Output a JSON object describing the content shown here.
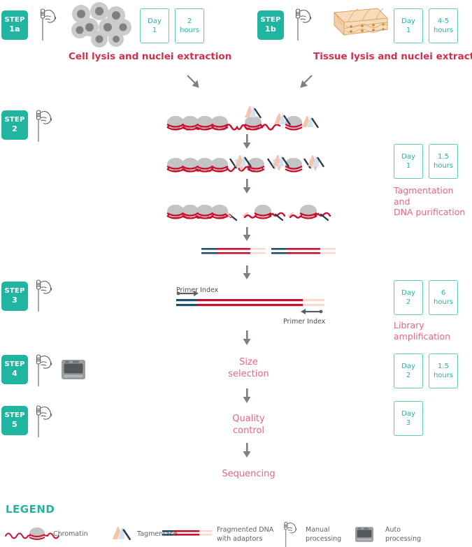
{
  "colors": {
    "teal": "#1fb5a0",
    "teal_light": "#62c9bd",
    "crimson": "#d2304a",
    "pink": "#e2697e",
    "gray_arrow": "#7d8083",
    "dna_red": "#c8102e",
    "dna_blue": "#1d4f6e",
    "dna_pale": "#fbd9d2",
    "nucleosome": "#c2c4c6",
    "tissue": "#f6d9b8",
    "tissue_line": "#d8953f"
  },
  "rows": {
    "step1a": {
      "badge_label": "STEP",
      "badge_num": "1a",
      "icon_manual": "hand-pipette-icon",
      "icon_sample": "cell-cluster-icon",
      "day": {
        "l1": "Day",
        "l2": "1"
      },
      "duration": {
        "l1": "2",
        "l2": "hours"
      },
      "caption": "Cell lysis and nuclei extraction"
    },
    "step1b": {
      "badge_label": "STEP",
      "badge_num": "1b",
      "icon_manual": "hand-pipette-icon",
      "icon_sample": "tissue-block-icon",
      "day": {
        "l1": "Day",
        "l2": "1"
      },
      "duration": {
        "l1": "4-5",
        "l2": "hours"
      },
      "caption": "Tissue lysis and nuclei extraction"
    },
    "step2": {
      "badge_label": "STEP",
      "badge_num": "2",
      "icon_manual": "hand-pipette-icon",
      "day": {
        "l1": "Day",
        "l2": "1"
      },
      "duration": {
        "l1": "1.5",
        "l2": "hours"
      },
      "side_label": "Tagmentation and\nDNA purification"
    },
    "step3": {
      "badge_label": "STEP",
      "badge_num": "3",
      "icon_manual": "hand-pipette-icon",
      "day": {
        "l1": "Day",
        "l2": "2"
      },
      "duration": {
        "l1": "6",
        "l2": "hours"
      },
      "side_label": "Library\namplification",
      "primer_top": "Primer Index",
      "primer_bottom": "Primer Index"
    },
    "step4": {
      "badge_label": "STEP",
      "badge_num": "4",
      "icon_manual": "hand-pipette-icon",
      "icon_auto": "auto-processor-icon",
      "day": {
        "l1": "Day",
        "l2": "2"
      },
      "duration": {
        "l1": "1.5",
        "l2": "hours"
      },
      "flow_label": "Size\nselection"
    },
    "step5": {
      "badge_label": "STEP",
      "badge_num": "5",
      "icon_manual": "hand-pipette-icon",
      "day": {
        "l1": "Day",
        "l2": "3"
      },
      "flow_label": "Quality\ncontrol"
    },
    "final": {
      "flow_label": "Sequencing"
    }
  },
  "legend": {
    "title": "LEGEND",
    "items": [
      {
        "icon": "chromatin-icon",
        "label": "Chromatin"
      },
      {
        "icon": "tagmentase-icon",
        "label": "Tagmentase"
      },
      {
        "icon": "fragmented-dna-icon",
        "label": "Fragmented DNA\nwith adaptors"
      },
      {
        "icon": "hand-pipette-icon",
        "label": "Manual\nprocessing"
      },
      {
        "icon": "auto-processor-icon",
        "label": "Auto\nprocessing"
      }
    ]
  }
}
